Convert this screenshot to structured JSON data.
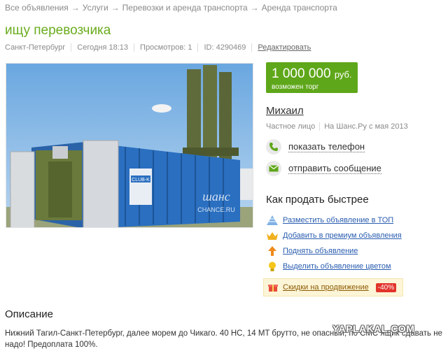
{
  "breadcrumb": {
    "items": [
      "Все объявления",
      "Услуги",
      "Перевозки и аренда транспорта",
      "Аренда транспорта"
    ],
    "separator": "→"
  },
  "listing": {
    "title": "ищу перевозчика",
    "city": "Санкт-Петербург",
    "date": "Сегодня 18:13",
    "views": "Просмотров: 1",
    "id": "ID: 4290469",
    "edit_label": "Редактировать",
    "photo_watermark": "шанс",
    "photo_watermark_sub": "CHANCE.RU",
    "photo_container_label": "CLUB-K"
  },
  "price": {
    "amount": "1 000 000",
    "currency": "руб.",
    "bargain": "возможен торг",
    "color": "#5fa71a"
  },
  "seller": {
    "name": "Михаил",
    "type": "Частное лицо",
    "since": "На Шанс.Ру с мая 2013",
    "show_phone": "показать телефон",
    "send_message": "отправить сообщение"
  },
  "sell_faster": {
    "title": "Как продать быстрее",
    "items": [
      {
        "label": "Разместить объявление в ТОП",
        "icon": "pyramid-icon"
      },
      {
        "label": "Добавить в премиум объявления",
        "icon": "crown-icon"
      },
      {
        "label": "Поднять объявление",
        "icon": "up-arrow-icon"
      },
      {
        "label": "Выделить объявление цветом",
        "icon": "lightbulb-icon"
      }
    ],
    "discount_label": "Скидки на продвижение",
    "discount_badge": "-40%",
    "discount_icon": "gift-icon"
  },
  "description": {
    "title": "Описание",
    "text": "Нижний Тагил-Санкт-Петербург, далее морем до Чикаго. 40 HC, 14 MT брутто, не опасный, по СМС ящик сдавать не надо! Предоплата 100%."
  },
  "watermark": "YAPLAKAL.COM"
}
